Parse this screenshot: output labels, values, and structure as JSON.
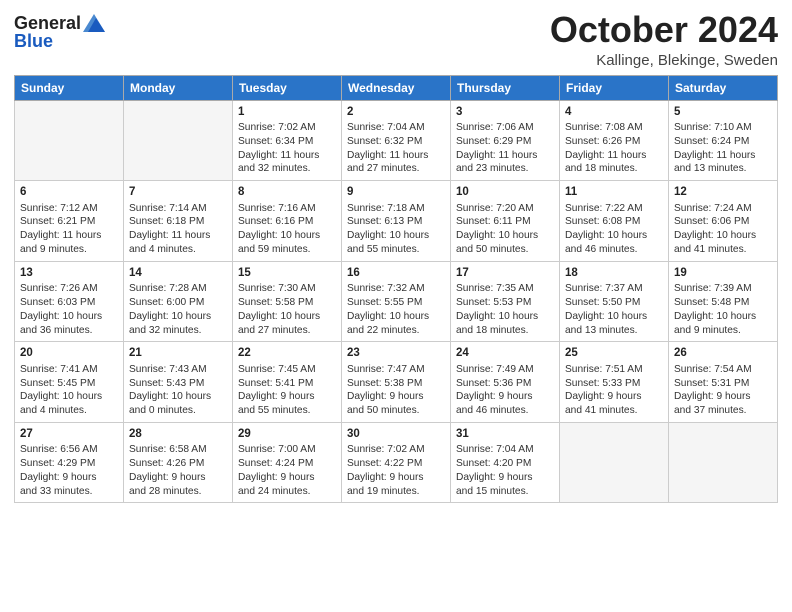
{
  "header": {
    "logo_general": "General",
    "logo_blue": "Blue",
    "month_title": "October 2024",
    "location": "Kallinge, Blekinge, Sweden"
  },
  "days_of_week": [
    "Sunday",
    "Monday",
    "Tuesday",
    "Wednesday",
    "Thursday",
    "Friday",
    "Saturday"
  ],
  "weeks": [
    [
      {
        "day": "",
        "info": ""
      },
      {
        "day": "",
        "info": ""
      },
      {
        "day": "1",
        "info": "Sunrise: 7:02 AM\nSunset: 6:34 PM\nDaylight: 11 hours\nand 32 minutes."
      },
      {
        "day": "2",
        "info": "Sunrise: 7:04 AM\nSunset: 6:32 PM\nDaylight: 11 hours\nand 27 minutes."
      },
      {
        "day": "3",
        "info": "Sunrise: 7:06 AM\nSunset: 6:29 PM\nDaylight: 11 hours\nand 23 minutes."
      },
      {
        "day": "4",
        "info": "Sunrise: 7:08 AM\nSunset: 6:26 PM\nDaylight: 11 hours\nand 18 minutes."
      },
      {
        "day": "5",
        "info": "Sunrise: 7:10 AM\nSunset: 6:24 PM\nDaylight: 11 hours\nand 13 minutes."
      }
    ],
    [
      {
        "day": "6",
        "info": "Sunrise: 7:12 AM\nSunset: 6:21 PM\nDaylight: 11 hours\nand 9 minutes."
      },
      {
        "day": "7",
        "info": "Sunrise: 7:14 AM\nSunset: 6:18 PM\nDaylight: 11 hours\nand 4 minutes."
      },
      {
        "day": "8",
        "info": "Sunrise: 7:16 AM\nSunset: 6:16 PM\nDaylight: 10 hours\nand 59 minutes."
      },
      {
        "day": "9",
        "info": "Sunrise: 7:18 AM\nSunset: 6:13 PM\nDaylight: 10 hours\nand 55 minutes."
      },
      {
        "day": "10",
        "info": "Sunrise: 7:20 AM\nSunset: 6:11 PM\nDaylight: 10 hours\nand 50 minutes."
      },
      {
        "day": "11",
        "info": "Sunrise: 7:22 AM\nSunset: 6:08 PM\nDaylight: 10 hours\nand 46 minutes."
      },
      {
        "day": "12",
        "info": "Sunrise: 7:24 AM\nSunset: 6:06 PM\nDaylight: 10 hours\nand 41 minutes."
      }
    ],
    [
      {
        "day": "13",
        "info": "Sunrise: 7:26 AM\nSunset: 6:03 PM\nDaylight: 10 hours\nand 36 minutes."
      },
      {
        "day": "14",
        "info": "Sunrise: 7:28 AM\nSunset: 6:00 PM\nDaylight: 10 hours\nand 32 minutes."
      },
      {
        "day": "15",
        "info": "Sunrise: 7:30 AM\nSunset: 5:58 PM\nDaylight: 10 hours\nand 27 minutes."
      },
      {
        "day": "16",
        "info": "Sunrise: 7:32 AM\nSunset: 5:55 PM\nDaylight: 10 hours\nand 22 minutes."
      },
      {
        "day": "17",
        "info": "Sunrise: 7:35 AM\nSunset: 5:53 PM\nDaylight: 10 hours\nand 18 minutes."
      },
      {
        "day": "18",
        "info": "Sunrise: 7:37 AM\nSunset: 5:50 PM\nDaylight: 10 hours\nand 13 minutes."
      },
      {
        "day": "19",
        "info": "Sunrise: 7:39 AM\nSunset: 5:48 PM\nDaylight: 10 hours\nand 9 minutes."
      }
    ],
    [
      {
        "day": "20",
        "info": "Sunrise: 7:41 AM\nSunset: 5:45 PM\nDaylight: 10 hours\nand 4 minutes."
      },
      {
        "day": "21",
        "info": "Sunrise: 7:43 AM\nSunset: 5:43 PM\nDaylight: 10 hours\nand 0 minutes."
      },
      {
        "day": "22",
        "info": "Sunrise: 7:45 AM\nSunset: 5:41 PM\nDaylight: 9 hours\nand 55 minutes."
      },
      {
        "day": "23",
        "info": "Sunrise: 7:47 AM\nSunset: 5:38 PM\nDaylight: 9 hours\nand 50 minutes."
      },
      {
        "day": "24",
        "info": "Sunrise: 7:49 AM\nSunset: 5:36 PM\nDaylight: 9 hours\nand 46 minutes."
      },
      {
        "day": "25",
        "info": "Sunrise: 7:51 AM\nSunset: 5:33 PM\nDaylight: 9 hours\nand 41 minutes."
      },
      {
        "day": "26",
        "info": "Sunrise: 7:54 AM\nSunset: 5:31 PM\nDaylight: 9 hours\nand 37 minutes."
      }
    ],
    [
      {
        "day": "27",
        "info": "Sunrise: 6:56 AM\nSunset: 4:29 PM\nDaylight: 9 hours\nand 33 minutes."
      },
      {
        "day": "28",
        "info": "Sunrise: 6:58 AM\nSunset: 4:26 PM\nDaylight: 9 hours\nand 28 minutes."
      },
      {
        "day": "29",
        "info": "Sunrise: 7:00 AM\nSunset: 4:24 PM\nDaylight: 9 hours\nand 24 minutes."
      },
      {
        "day": "30",
        "info": "Sunrise: 7:02 AM\nSunset: 4:22 PM\nDaylight: 9 hours\nand 19 minutes."
      },
      {
        "day": "31",
        "info": "Sunrise: 7:04 AM\nSunset: 4:20 PM\nDaylight: 9 hours\nand 15 minutes."
      },
      {
        "day": "",
        "info": ""
      },
      {
        "day": "",
        "info": ""
      }
    ]
  ]
}
